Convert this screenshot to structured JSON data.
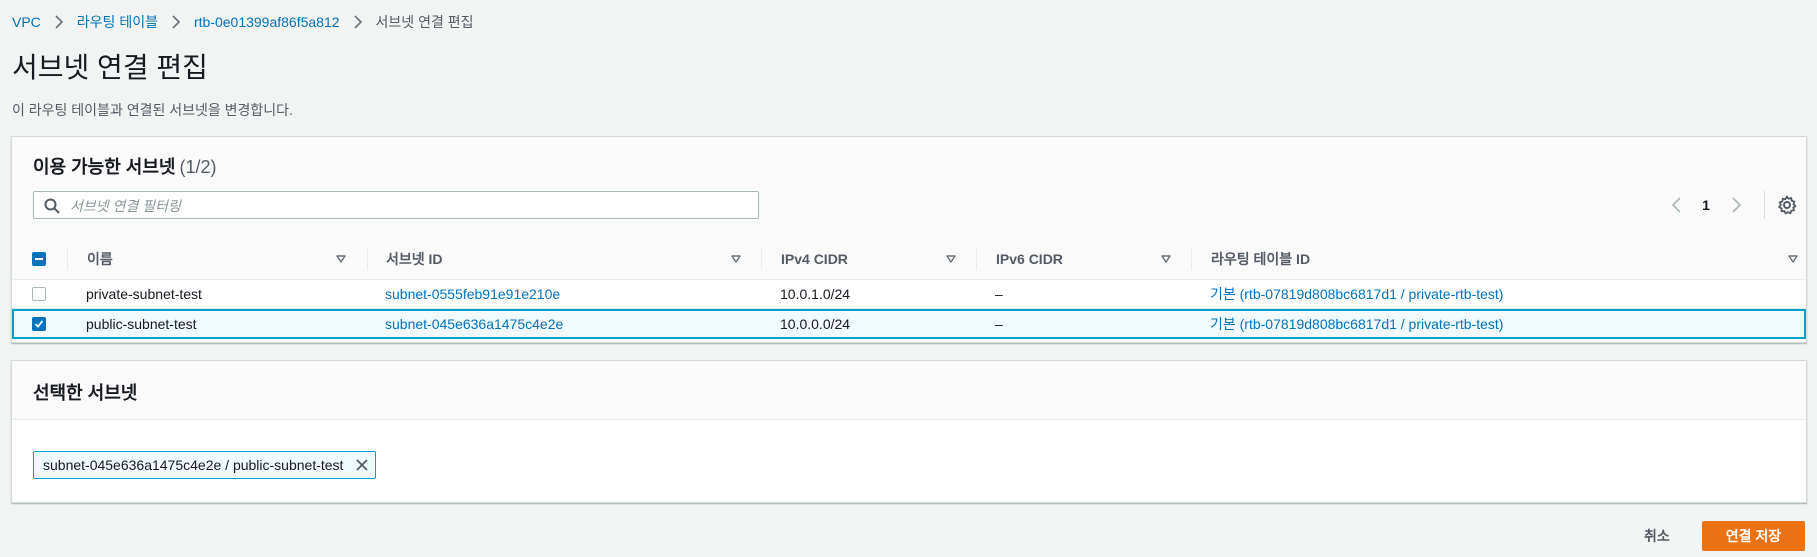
{
  "breadcrumb": {
    "items": [
      "VPC",
      "라우팅 테이블",
      "rtb-0e01399af86f5a812"
    ],
    "current": "서브넷 연결 편집"
  },
  "page": {
    "title": "서브넷 연결 편집",
    "description": "이 라우팅 테이블과 연결된 서브넷을 변경합니다."
  },
  "available": {
    "title": "이용 가능한 서브넷",
    "count": "(1/2)",
    "filter_placeholder": "서브넷 연결 필터링",
    "page_number": "1",
    "columns": [
      "이름",
      "서브넷 ID",
      "IPv4 CIDR",
      "IPv6 CIDR",
      "라우팅 테이블 ID"
    ],
    "rows": [
      {
        "selected": false,
        "name": "private-subnet-test",
        "subnet_id": "subnet-0555feb91e91e210e",
        "ipv4": "10.0.1.0/24",
        "ipv6": "–",
        "route_table": "기본 (rtb-07819d808bc6817d1 / private-rtb-test)"
      },
      {
        "selected": true,
        "name": "public-subnet-test",
        "subnet_id": "subnet-045e636a1475c4e2e",
        "ipv4": "10.0.0.0/24",
        "ipv6": "–",
        "route_table": "기본 (rtb-07819d808bc6817d1 / private-rtb-test)"
      }
    ]
  },
  "selected": {
    "title": "선택한 서브넷",
    "tokens": [
      "subnet-045e636a1475c4e2e / public-subnet-test"
    ]
  },
  "footer": {
    "cancel_label": "취소",
    "save_label": "연결 저장"
  },
  "colors": {
    "link": "#0073bb",
    "primary_button": "#ec7211",
    "selected_row_border": "#00a1c9",
    "checkbox": "#0073bb"
  },
  "icons": [
    "chevron-right-icon",
    "search-icon",
    "chevron-left-icon",
    "gear-icon",
    "sort-down-icon",
    "check-icon",
    "close-icon"
  ]
}
